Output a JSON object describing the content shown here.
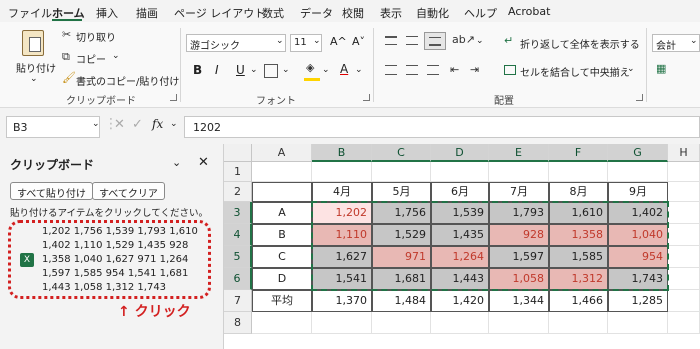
{
  "colors": {
    "accent": "#217346",
    "selection_fill": "#c6c6c6",
    "active_cell_fill": "#fde3e3",
    "negative_fill": "#e8b8b4",
    "red_text": "#c0392b",
    "annotation_red": "#d32020"
  },
  "menu": {
    "tabs": [
      "ファイル",
      "ホーム",
      "挿入",
      "描画",
      "ページ レイアウト",
      "数式",
      "データ",
      "校閲",
      "表示",
      "自動化",
      "ヘルプ",
      "Acrobat"
    ],
    "active_tab": "ホーム"
  },
  "ribbon": {
    "clipboard": {
      "paste": "貼り付け",
      "cut": "切り取り",
      "copy": "コピー",
      "format_painter": "書式のコピー/貼り付け",
      "group_label": "クリップボード"
    },
    "font": {
      "font_name": "游ゴシック",
      "font_size": "11",
      "grow_icon": "A^",
      "shrink_icon": "A˅",
      "bold": "B",
      "italic": "I",
      "underline": "U",
      "font_color_icon": "A",
      "group_label": "フォント"
    },
    "alignment": {
      "wrap_text": "折り返して全体を表示する",
      "merge_center": "セルを結合して中央揃え",
      "group_label": "配置"
    },
    "number": {
      "format": "会計"
    }
  },
  "formula_bar": {
    "name_box": "B3",
    "fx": "fx",
    "value": "1202"
  },
  "clipboard_pane": {
    "title": "クリップボード",
    "paste_all": "すべて貼り付け",
    "clear_all": "すべてクリア",
    "instruction": "貼り付けるアイテムをクリックしてください。",
    "item_lines": [
      "1,202 1,756 1,539 1,793 1,610",
      "1,402 1,110 1,529 1,435 928",
      "1,358 1,040 1,627 971 1,264",
      "1,597 1,585 954 1,541 1,681",
      "1,443 1,058 1,312 1,743"
    ],
    "annotation": "↑ クリック"
  },
  "sheet": {
    "col_headers": [
      "A",
      "B",
      "C",
      "D",
      "E",
      "F",
      "G",
      "H"
    ],
    "row_headers": [
      "1",
      "2",
      "3",
      "4",
      "5",
      "6",
      "7",
      "8"
    ],
    "months": [
      "4月",
      "5月",
      "6月",
      "7月",
      "8月",
      "9月"
    ],
    "rows": [
      {
        "label": "A",
        "values": [
          "1,202",
          "1,756",
          "1,539",
          "1,793",
          "1,610",
          "1,402"
        ]
      },
      {
        "label": "B",
        "values": [
          "1,110",
          "1,529",
          "1,435",
          "928",
          "1,358",
          "1,040"
        ]
      },
      {
        "label": "C",
        "values": [
          "1,627",
          "971",
          "1,264",
          "1,597",
          "1,585",
          "954"
        ]
      },
      {
        "label": "D",
        "values": [
          "1,541",
          "1,681",
          "1,443",
          "1,058",
          "1,312",
          "1,743"
        ]
      }
    ],
    "avg_label": "平均",
    "avg_values": [
      "1,370",
      "1,484",
      "1,420",
      "1,344",
      "1,466",
      "1,285"
    ],
    "red_text_cells": [
      "3-0",
      "4-0",
      "4-3",
      "4-4",
      "4-5",
      "5-1",
      "5-2",
      "5-5",
      "6-3",
      "6-4"
    ],
    "pink_cells": [
      "4-0",
      "4-3",
      "4-4",
      "4-5",
      "5-1",
      "5-2",
      "5-5",
      "6-3",
      "6-4"
    ]
  }
}
